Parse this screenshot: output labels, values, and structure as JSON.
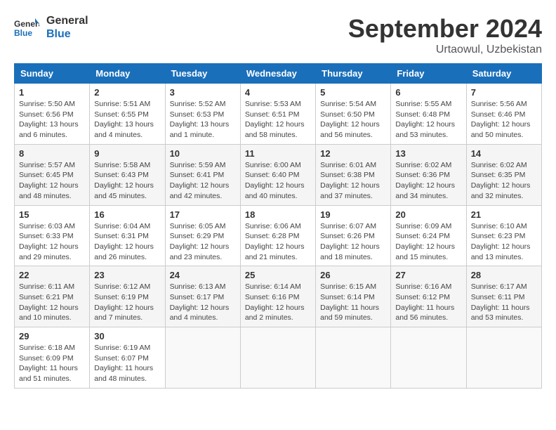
{
  "header": {
    "logo_line1": "General",
    "logo_line2": "Blue",
    "month": "September 2024",
    "location": "Urtaowul, Uzbekistan"
  },
  "weekdays": [
    "Sunday",
    "Monday",
    "Tuesday",
    "Wednesday",
    "Thursday",
    "Friday",
    "Saturday"
  ],
  "weeks": [
    [
      {
        "day": "1",
        "sunrise": "5:50 AM",
        "sunset": "6:56 PM",
        "daylight": "13 hours and 6 minutes."
      },
      {
        "day": "2",
        "sunrise": "5:51 AM",
        "sunset": "6:55 PM",
        "daylight": "13 hours and 4 minutes."
      },
      {
        "day": "3",
        "sunrise": "5:52 AM",
        "sunset": "6:53 PM",
        "daylight": "13 hours and 1 minute."
      },
      {
        "day": "4",
        "sunrise": "5:53 AM",
        "sunset": "6:51 PM",
        "daylight": "12 hours and 58 minutes."
      },
      {
        "day": "5",
        "sunrise": "5:54 AM",
        "sunset": "6:50 PM",
        "daylight": "12 hours and 56 minutes."
      },
      {
        "day": "6",
        "sunrise": "5:55 AM",
        "sunset": "6:48 PM",
        "daylight": "12 hours and 53 minutes."
      },
      {
        "day": "7",
        "sunrise": "5:56 AM",
        "sunset": "6:46 PM",
        "daylight": "12 hours and 50 minutes."
      }
    ],
    [
      {
        "day": "8",
        "sunrise": "5:57 AM",
        "sunset": "6:45 PM",
        "daylight": "12 hours and 48 minutes."
      },
      {
        "day": "9",
        "sunrise": "5:58 AM",
        "sunset": "6:43 PM",
        "daylight": "12 hours and 45 minutes."
      },
      {
        "day": "10",
        "sunrise": "5:59 AM",
        "sunset": "6:41 PM",
        "daylight": "12 hours and 42 minutes."
      },
      {
        "day": "11",
        "sunrise": "6:00 AM",
        "sunset": "6:40 PM",
        "daylight": "12 hours and 40 minutes."
      },
      {
        "day": "12",
        "sunrise": "6:01 AM",
        "sunset": "6:38 PM",
        "daylight": "12 hours and 37 minutes."
      },
      {
        "day": "13",
        "sunrise": "6:02 AM",
        "sunset": "6:36 PM",
        "daylight": "12 hours and 34 minutes."
      },
      {
        "day": "14",
        "sunrise": "6:02 AM",
        "sunset": "6:35 PM",
        "daylight": "12 hours and 32 minutes."
      }
    ],
    [
      {
        "day": "15",
        "sunrise": "6:03 AM",
        "sunset": "6:33 PM",
        "daylight": "12 hours and 29 minutes."
      },
      {
        "day": "16",
        "sunrise": "6:04 AM",
        "sunset": "6:31 PM",
        "daylight": "12 hours and 26 minutes."
      },
      {
        "day": "17",
        "sunrise": "6:05 AM",
        "sunset": "6:29 PM",
        "daylight": "12 hours and 23 minutes."
      },
      {
        "day": "18",
        "sunrise": "6:06 AM",
        "sunset": "6:28 PM",
        "daylight": "12 hours and 21 minutes."
      },
      {
        "day": "19",
        "sunrise": "6:07 AM",
        "sunset": "6:26 PM",
        "daylight": "12 hours and 18 minutes."
      },
      {
        "day": "20",
        "sunrise": "6:09 AM",
        "sunset": "6:24 PM",
        "daylight": "12 hours and 15 minutes."
      },
      {
        "day": "21",
        "sunrise": "6:10 AM",
        "sunset": "6:23 PM",
        "daylight": "12 hours and 13 minutes."
      }
    ],
    [
      {
        "day": "22",
        "sunrise": "6:11 AM",
        "sunset": "6:21 PM",
        "daylight": "12 hours and 10 minutes."
      },
      {
        "day": "23",
        "sunrise": "6:12 AM",
        "sunset": "6:19 PM",
        "daylight": "12 hours and 7 minutes."
      },
      {
        "day": "24",
        "sunrise": "6:13 AM",
        "sunset": "6:17 PM",
        "daylight": "12 hours and 4 minutes."
      },
      {
        "day": "25",
        "sunrise": "6:14 AM",
        "sunset": "6:16 PM",
        "daylight": "12 hours and 2 minutes."
      },
      {
        "day": "26",
        "sunrise": "6:15 AM",
        "sunset": "6:14 PM",
        "daylight": "11 hours and 59 minutes."
      },
      {
        "day": "27",
        "sunrise": "6:16 AM",
        "sunset": "6:12 PM",
        "daylight": "11 hours and 56 minutes."
      },
      {
        "day": "28",
        "sunrise": "6:17 AM",
        "sunset": "6:11 PM",
        "daylight": "11 hours and 53 minutes."
      }
    ],
    [
      {
        "day": "29",
        "sunrise": "6:18 AM",
        "sunset": "6:09 PM",
        "daylight": "11 hours and 51 minutes."
      },
      {
        "day": "30",
        "sunrise": "6:19 AM",
        "sunset": "6:07 PM",
        "daylight": "11 hours and 48 minutes."
      },
      null,
      null,
      null,
      null,
      null
    ]
  ]
}
